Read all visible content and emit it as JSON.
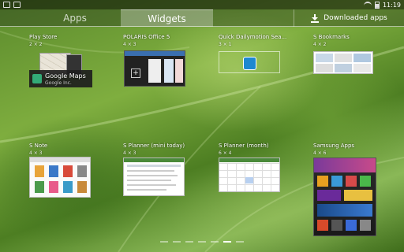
{
  "status_bar": {
    "time": "11:19"
  },
  "tabs": [
    {
      "label": "Apps"
    },
    {
      "label": "Widgets"
    },
    {
      "label": "Downloaded apps"
    }
  ],
  "widgets": [
    {
      "title": "Play Store",
      "size": "2 × 2",
      "app_name": "Google Maps",
      "developer": "Google Inc."
    },
    {
      "title": "POLARIS Office 5",
      "size": "4 × 3"
    },
    {
      "title": "Quick Dailymotion Sea...",
      "size": "3 × 1"
    },
    {
      "title": "S Bookmarks",
      "size": "4 × 2"
    },
    {
      "title": "S Note",
      "size": "4 × 3"
    },
    {
      "title": "S Planner (mini today)",
      "size": "4 × 3"
    },
    {
      "title": "S Planner (month)",
      "size": "6 × 4"
    },
    {
      "title": "Samsung Apps",
      "size": "4 × 6"
    }
  ],
  "pagination": {
    "count": 7,
    "active_index": 5
  },
  "colors": {
    "accent": "#1e88d0",
    "tab_selected": "rgba(255,255,255,0.3)"
  },
  "icons": [
    "status-icon",
    "wifi-icon",
    "battery-icon",
    "download-icon",
    "google-maps-icon",
    "add-icon",
    "dailymotion-icon"
  ]
}
